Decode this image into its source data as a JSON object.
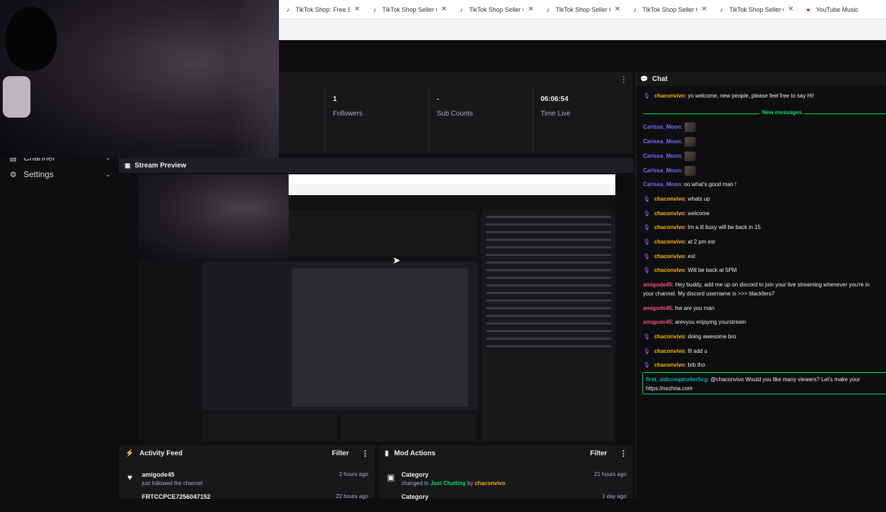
{
  "browser": {
    "tabs": [
      {
        "icon": "tiktok-icon",
        "title": "TikTok Shop: Free Shop"
      },
      {
        "icon": "tiktok-icon",
        "title": "TikTok Shop Seller Cen"
      },
      {
        "icon": "tiktok-icon",
        "title": "TikTok Shop Seller Cen"
      },
      {
        "icon": "tiktok-icon",
        "title": "TikTok Shop Seller Cen"
      },
      {
        "icon": "tiktok-icon",
        "title": "TikTok Shop Seller Cen"
      },
      {
        "icon": "tiktok-icon",
        "title": "TikTok Shop Seller Cen"
      },
      {
        "icon": "youtube-music-icon",
        "title": "YouTube Music"
      }
    ]
  },
  "sidebar": {
    "items": [
      {
        "label": "Channel",
        "icon": "channel-icon"
      },
      {
        "label": "Settings",
        "icon": "gear-icon"
      }
    ]
  },
  "stats": [
    {
      "value": "1",
      "label": "Followers"
    },
    {
      "value": "-",
      "label": "Sub Counts"
    },
    {
      "value": "06:06:54",
      "label": "Time Live"
    }
  ],
  "stream_preview": {
    "title": "Stream Preview"
  },
  "activity_feed": {
    "title": "Activity Feed",
    "filter": "Filter",
    "rows": [
      {
        "name": "amigode45",
        "desc": "just followed the channel",
        "time": "2 hours ago"
      },
      {
        "name": "FRTCCPCE7256047152",
        "desc": "",
        "time": "22 hours ago"
      }
    ]
  },
  "mod_actions": {
    "title": "Mod Actions",
    "filter": "Filter",
    "rows": [
      {
        "name": "Category",
        "desc_prefix": "changed to",
        "category": "Just Chatting",
        "by": "by",
        "user": "chaconvivo",
        "time": "21 hours ago"
      },
      {
        "name": "Category",
        "time": "1 day ago"
      }
    ]
  },
  "chat": {
    "title": "Chat",
    "new_messages_label": "New messages",
    "messages": [
      {
        "user": "chaconvivo",
        "color": "#ffb31a",
        "badge": true,
        "text": ": yo welcome, new people, please feel free to say Hi!"
      },
      {
        "user": "Carissa_Moon",
        "color": "#7c6bff",
        "badge": false,
        "text": ":",
        "emote": true
      },
      {
        "user": "Carissa_Moon",
        "color": "#7c6bff",
        "badge": false,
        "text": ":",
        "emote": true
      },
      {
        "user": "Carissa_Moon",
        "color": "#7c6bff",
        "badge": false,
        "text": ":",
        "emote": true
      },
      {
        "user": "Carissa_Moon",
        "color": "#7c6bff",
        "badge": false,
        "text": ":",
        "emote": true
      },
      {
        "user": "Carissa_Moon",
        "color": "#7c6bff",
        "badge": false,
        "text": ": oo what's good man !"
      },
      {
        "user": "chaconvivo",
        "color": "#ffb31a",
        "badge": true,
        "text": ": whats up"
      },
      {
        "user": "chaconvivo",
        "color": "#ffb31a",
        "badge": true,
        "text": ": welcome"
      },
      {
        "user": "chaconvivo",
        "color": "#ffb31a",
        "badge": true,
        "text": ": Im a lil busy will be back in 15"
      },
      {
        "user": "chaconvivo",
        "color": "#ffb31a",
        "badge": true,
        "text": ": at 2 pm esr"
      },
      {
        "user": "chaconvivo",
        "color": "#ffb31a",
        "badge": true,
        "text": ": est"
      },
      {
        "user": "chaconvivo",
        "color": "#ffb31a",
        "badge": true,
        "text": ": Will be back at 5PM"
      },
      {
        "user": "amigode45",
        "color": "#ff4d6d",
        "badge": false,
        "text": ": Hey buddy, add me up on discord to join your live streaming whenever you're in"
      },
      {
        "user": "",
        "color": "#efeff1",
        "badge": false,
        "text": "your channel. My discord username is >>> blackfero7"
      },
      {
        "user": "amigode45",
        "color": "#ff4d6d",
        "badge": false,
        "text": ": hw are you man"
      },
      {
        "user": "amigode45",
        "color": "#ff4d6d",
        "badge": false,
        "text": ": arevyou enjoying yourstream"
      },
      {
        "user": "chaconvivo",
        "color": "#ffb31a",
        "badge": true,
        "text": ": doing awesome bro"
      },
      {
        "user": "chaconvivo",
        "color": "#ffb31a",
        "badge": true,
        "text": ": Ill add u"
      },
      {
        "user": "chaconvivo",
        "color": "#ffb31a",
        "badge": true,
        "text": ": brb tho"
      },
      {
        "user": "first_aidcomptroller5cg",
        "color": "#00b5ad",
        "badge": false,
        "text": ": @chaconvivo Would you like many viewers? Let's make your"
      },
      {
        "user": "",
        "color": "#efeff1",
        "badge": false,
        "text": "https://nezhna.com"
      }
    ]
  },
  "colors": {
    "accent_green": "#00e15b",
    "background": "#0e0e10",
    "panel": "#18181b"
  }
}
